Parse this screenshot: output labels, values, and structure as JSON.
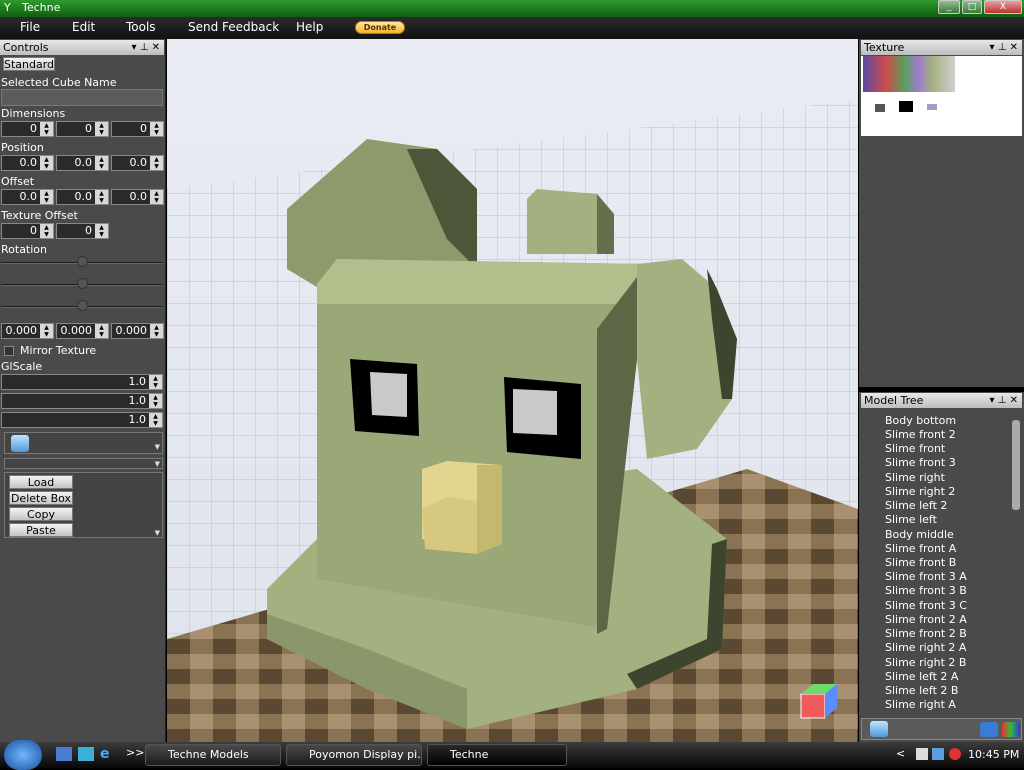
{
  "window": {
    "title": "Techne"
  },
  "menu": {
    "items": [
      "File",
      "Edit",
      "Tools",
      "Send Feedback",
      "Help"
    ],
    "donate": "Donate"
  },
  "controls": {
    "title": "Controls",
    "standard_button": "Standard",
    "selected_cube_label": "Selected Cube Name",
    "selected_cube_value": "",
    "dimensions_label": "Dimensions",
    "dimensions": [
      "0",
      "0",
      "0"
    ],
    "position_label": "Position",
    "position": [
      "0.0",
      "0.0",
      "0.0"
    ],
    "offset_label": "Offset",
    "offset": [
      "0.0",
      "0.0",
      "0.0"
    ],
    "texture_offset_label": "Texture Offset",
    "texture_offset": [
      "0",
      "0"
    ],
    "rotation_label": "Rotation",
    "rotation_values": [
      "0.000",
      "0.000",
      "0.000"
    ],
    "mirror_label": "Mirror Texture",
    "mirror_checked": false,
    "glscale_label": "GlScale",
    "glscale": [
      "1.0",
      "1.0",
      "1.0"
    ],
    "actions": [
      "Load Texture",
      "Delete Box",
      "Copy",
      "Paste"
    ]
  },
  "texture_panel": {
    "title": "Texture"
  },
  "model_tree": {
    "title": "Model Tree",
    "items": [
      "Body bottom",
      "Slime front 2",
      "Slime front",
      "Slime front 3",
      "Slime right",
      "Slime right 2",
      "Slime left 2",
      "Slime left",
      "Body middle",
      "Slime front A",
      "Slime front B",
      "Slime front 3 A",
      "Slime front 3 B",
      "Slime front 3 C",
      "Slime front 2 A",
      "Slime front 2 B",
      "Slime right 2 A",
      "Slime right 2 B",
      "Slime left 2 A",
      "Slime left 2 B",
      "Slime right  A"
    ]
  },
  "taskbar": {
    "tasks": [
      "Techne Models",
      "Poyomon Display pi...",
      "Techne"
    ],
    "clock": "10:45 PM",
    "expand": ">>",
    "tray_arrow": "<"
  },
  "colors": {
    "titlebar": "#1f7f1f",
    "model_body": "#a3b07f",
    "beak": "#e2d590",
    "floor_dark": "#5b4832",
    "floor_light": "#9b8462"
  }
}
